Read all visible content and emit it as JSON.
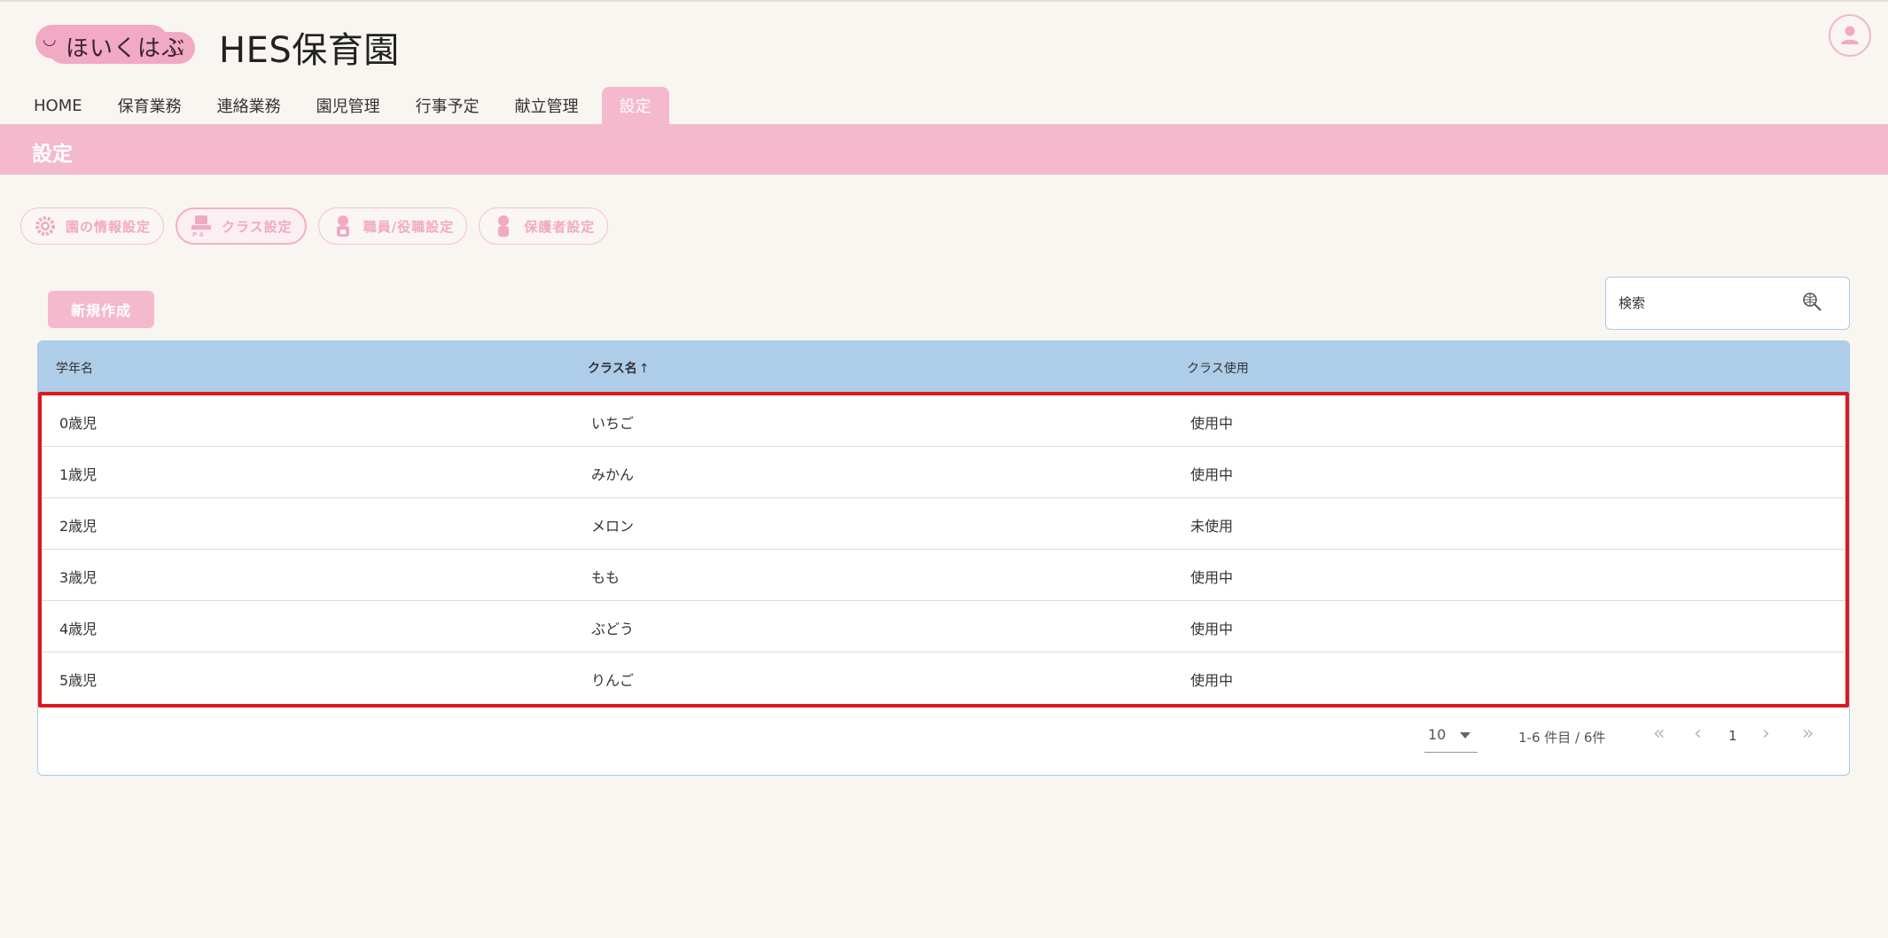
{
  "header": {
    "logo_text": "ほいくはぶ",
    "site_title": "HES保育園"
  },
  "nav": {
    "items": [
      "HOME",
      "保育業務",
      "連絡業務",
      "園児管理",
      "行事予定",
      "献立管理"
    ],
    "active": "設定"
  },
  "page": {
    "title": "設定"
  },
  "settings_tabs": [
    {
      "label": "園の情報設定",
      "icon": "gear-icon"
    },
    {
      "label": "クラス設定",
      "icon": "class-icon"
    },
    {
      "label": "職員/役職設定",
      "icon": "staff-icon"
    },
    {
      "label": "保護者設定",
      "icon": "guardian-icon"
    }
  ],
  "actions": {
    "new_label": "新規作成"
  },
  "search": {
    "placeholder": "検索"
  },
  "table": {
    "headers": [
      "学年名",
      "クラス名",
      "クラス使用"
    ],
    "sort_indicator": "↑",
    "rows": [
      [
        "0歳児",
        "いちご",
        "使用中"
      ],
      [
        "1歳児",
        "みかん",
        "使用中"
      ],
      [
        "2歳児",
        "メロン",
        "未使用"
      ],
      [
        "3歳児",
        "もも",
        "使用中"
      ],
      [
        "4歳児",
        "ぶどう",
        "使用中"
      ],
      [
        "5歳児",
        "りんご",
        "使用中"
      ]
    ]
  },
  "pagination": {
    "per_page": "10",
    "range_text": "1-6 件目 / 6件",
    "current_page": "1",
    "first": "«",
    "prev": "‹",
    "next": "›",
    "last": "»"
  },
  "colors": {
    "accent_pink": "#f4b9cc",
    "table_header_blue": "#aecde9",
    "highlight_red": "#e0161e"
  }
}
